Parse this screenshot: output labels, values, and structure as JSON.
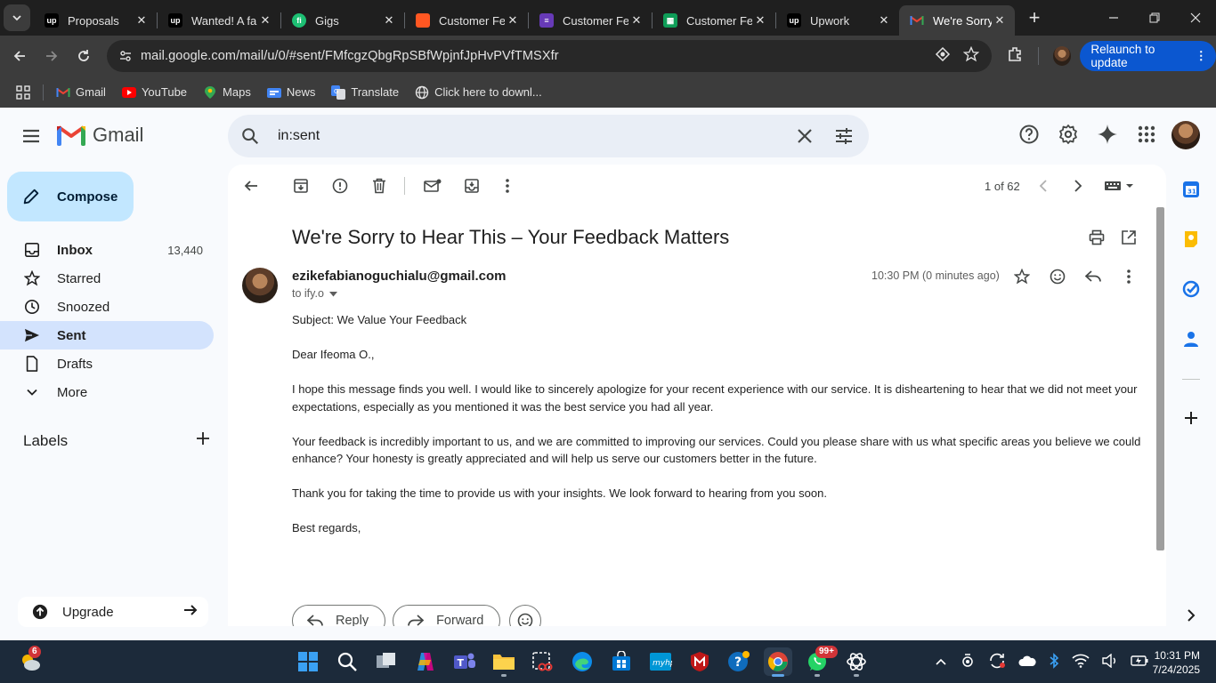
{
  "browser": {
    "tabs": [
      {
        "title": "Proposals",
        "favicon": "upwork-icon",
        "color": "#000000"
      },
      {
        "title": "Wanted! A fa",
        "favicon": "upwork-icon",
        "color": "#000000"
      },
      {
        "title": "Gigs",
        "favicon": "fiverr-icon",
        "color": "#1dbf73"
      },
      {
        "title": "Customer Fe",
        "favicon": "orange-square-icon",
        "color": "#ff5722"
      },
      {
        "title": "Customer Fe",
        "favicon": "forms-icon",
        "color": "#673ab7"
      },
      {
        "title": "Customer Fe",
        "favicon": "sheets-icon",
        "color": "#0f9d58"
      },
      {
        "title": "Upwork",
        "favicon": "upwork-icon",
        "color": "#000000"
      },
      {
        "title": "We're Sorry t",
        "favicon": "gmail-icon",
        "color": "#ea4335",
        "active": true
      }
    ],
    "url": "mail.google.com/mail/u/0/#sent/FMfcgzQbgRpSBfWpjnfJpHvPVfTMSXfr",
    "relaunch_label": "Relaunch to update",
    "bookmarks": [
      {
        "label": "Gmail",
        "icon": "gmail-icon"
      },
      {
        "label": "YouTube",
        "icon": "youtube-icon"
      },
      {
        "label": "Maps",
        "icon": "maps-icon"
      },
      {
        "label": "News",
        "icon": "news-icon"
      },
      {
        "label": "Translate",
        "icon": "translate-icon"
      },
      {
        "label": "Click here to downl...",
        "icon": "globe-icon"
      }
    ]
  },
  "gmail": {
    "logo_text": "Gmail",
    "search_value": "in:sent",
    "compose_label": "Compose",
    "nav": [
      {
        "label": "Inbox",
        "count": "13,440",
        "icon": "inbox-icon"
      },
      {
        "label": "Starred",
        "count": "",
        "icon": "star-icon"
      },
      {
        "label": "Snoozed",
        "count": "",
        "icon": "clock-icon"
      },
      {
        "label": "Sent",
        "count": "",
        "icon": "send-icon"
      },
      {
        "label": "Drafts",
        "count": "",
        "icon": "draft-icon"
      },
      {
        "label": "More",
        "count": "",
        "icon": "chevron-down-icon"
      }
    ],
    "labels_title": "Labels",
    "upgrade_label": "Upgrade",
    "pager": "1 of 62",
    "email": {
      "subject": "We're Sorry to Hear This – Your Feedback Matters",
      "sender": "ezikefabianoguchialu@gmail.com",
      "recipient": "to ify.o",
      "timestamp": "10:30 PM (0 minutes ago)",
      "body": [
        "Subject: We Value Your Feedback",
        "Dear Ifeoma O.,",
        "I hope this message finds you well. I would like to sincerely apologize for your recent experience with our service. It is disheartening to hear that we did not meet your expectations, especially as you mentioned it was the best service you had all year.",
        "Your feedback is incredibly important to us, and we are committed to improving our services. Could you please share with us what specific areas you believe we could enhance? Your honesty is greatly appreciated and will help us serve our customers better in the future.",
        "Thank you for taking the time to provide us with your insights. We look forward to hearing from you soon.",
        "Best regards,"
      ],
      "reply_label": "Reply",
      "forward_label": "Forward"
    }
  },
  "taskbar": {
    "weather_badge": "6",
    "whatsapp_badge": "99+",
    "time": "10:31 PM",
    "date": "7/24/2025"
  },
  "colors": {
    "accent": "#0b57d0",
    "compose_bg": "#c2e7ff",
    "active_nav_bg": "#d3e3fd"
  }
}
